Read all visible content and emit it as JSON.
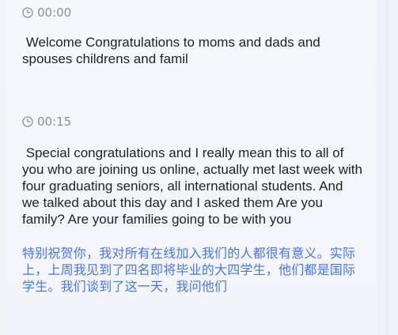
{
  "segments": [
    {
      "timestamp": "00:00",
      "text": " Welcome Congratulations to moms and dads and spouses childrens and famil"
    },
    {
      "timestamp": "00:15",
      "text": " Special congratulations and I really mean this to all of you who are joining us online, actually met last week with four graduating seniors, all international students. And we talked about this day and I asked them Are you family? Are your families going to be with you",
      "translation": "特别祝贺你，我对所有在线加入我们的人都很有意义。实际上，上周我见到了四名即将毕业的大四学生，他们都是国际学生。我们谈到了这一天，我问他们"
    }
  ],
  "icons": {
    "timestamp_icon": "clock-icon"
  },
  "colors": {
    "timestamp": "#8a8f9c",
    "text": "#1f2126",
    "translation": "#4a78d9"
  }
}
